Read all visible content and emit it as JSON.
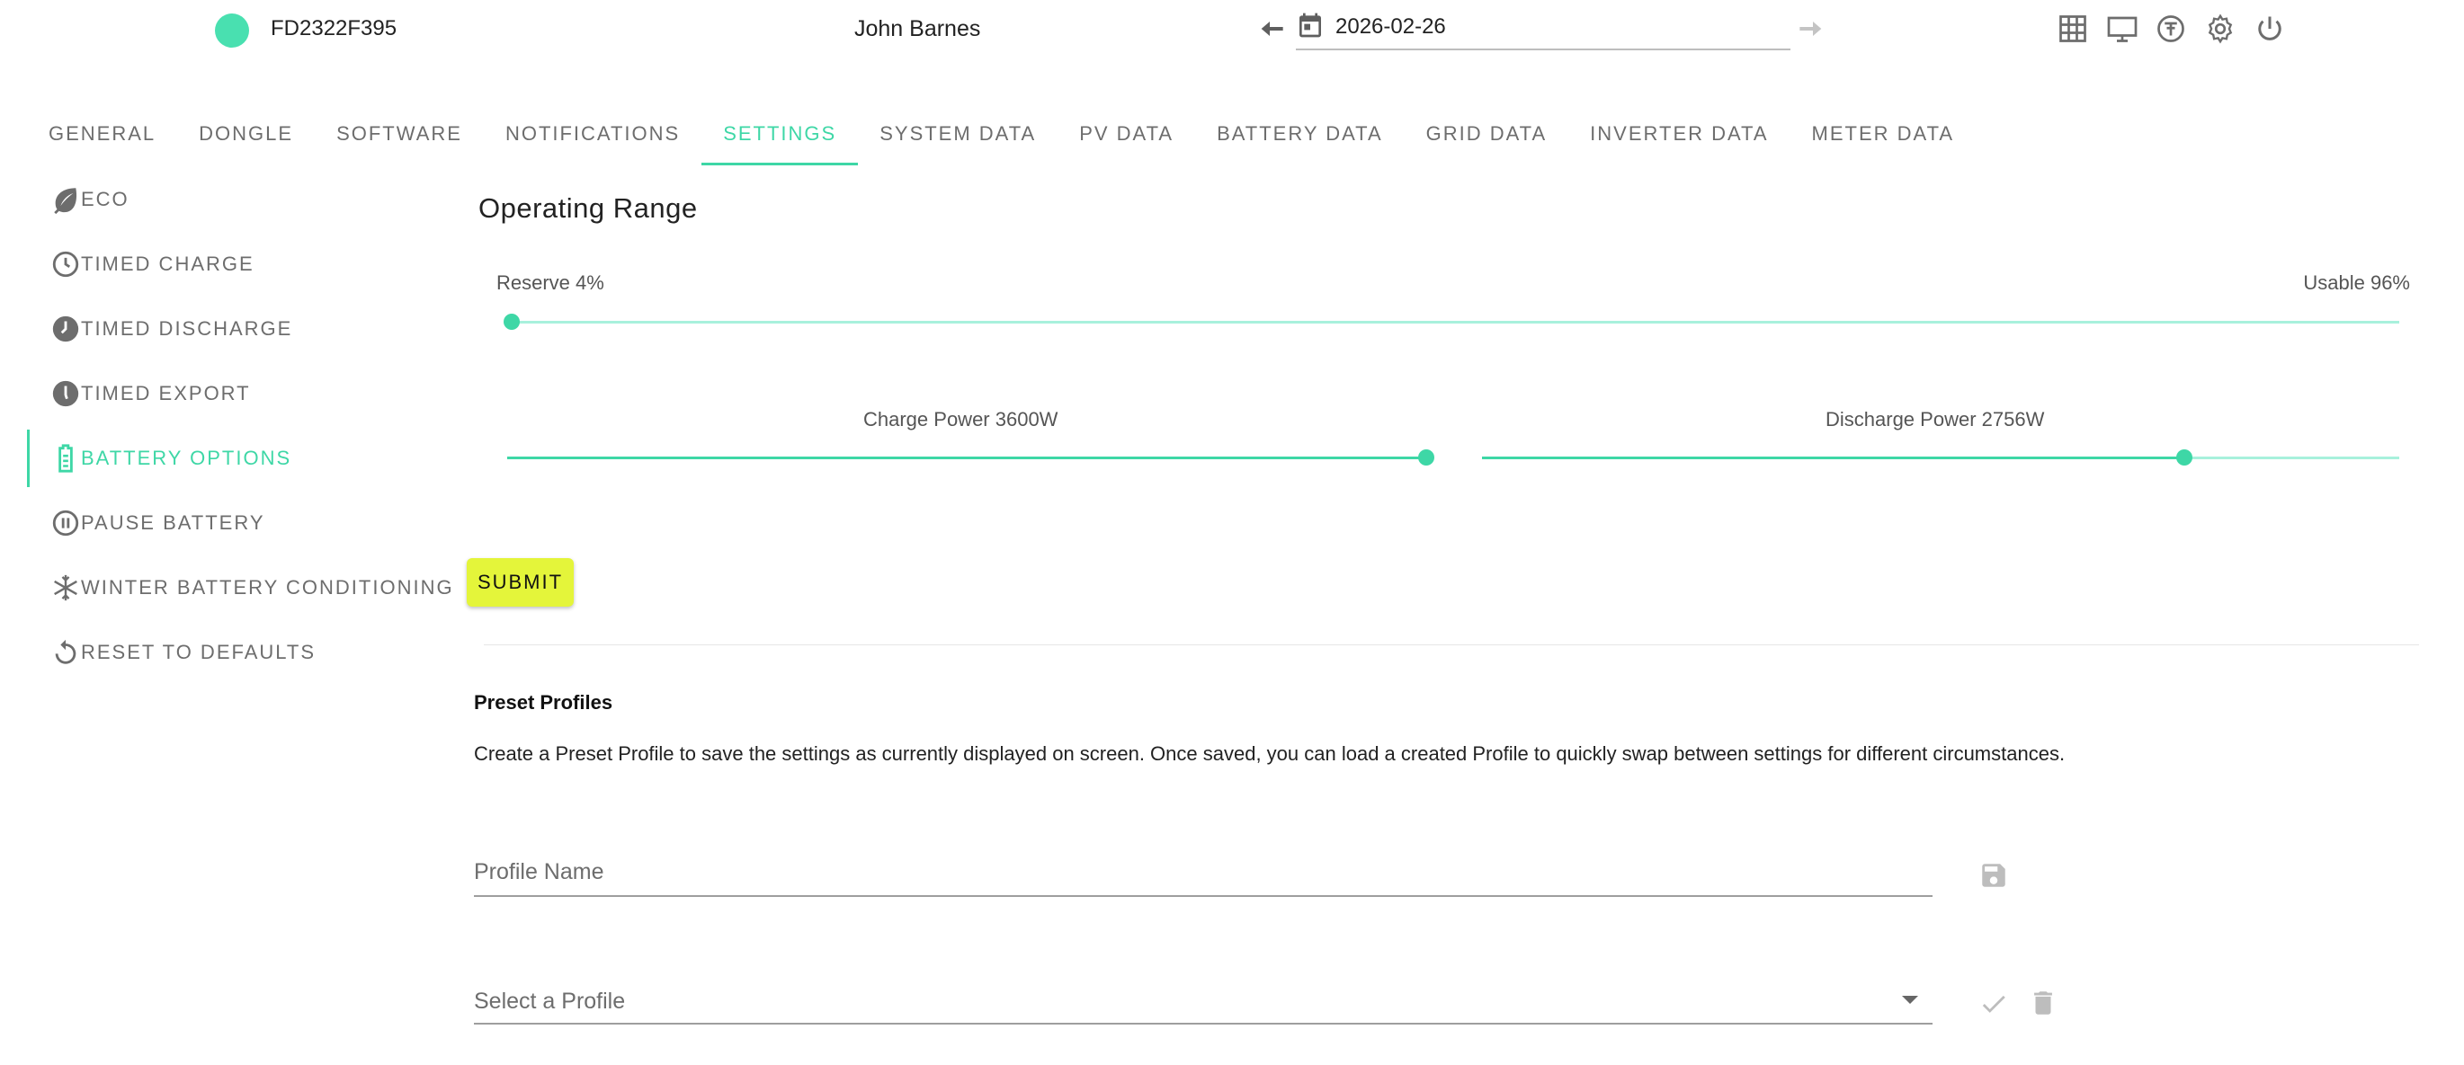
{
  "header": {
    "serial": "FD2322F395",
    "user_name": "John Barnes",
    "date": "2026-02-26",
    "status_color": "#49e0b0",
    "icons": [
      "grid-icon",
      "monitor-icon",
      "tariff-icon",
      "settings-icon",
      "power-icon"
    ]
  },
  "tabs": [
    {
      "label": "GENERAL"
    },
    {
      "label": "DONGLE"
    },
    {
      "label": "SOFTWARE"
    },
    {
      "label": "NOTIFICATIONS"
    },
    {
      "label": "SETTINGS",
      "active": true
    },
    {
      "label": "SYSTEM DATA"
    },
    {
      "label": "PV DATA"
    },
    {
      "label": "BATTERY DATA"
    },
    {
      "label": "GRID DATA"
    },
    {
      "label": "INVERTER DATA"
    },
    {
      "label": "METER DATA"
    }
  ],
  "side_menu": {
    "items": [
      {
        "label": "ECO",
        "icon": "leaf-icon"
      },
      {
        "label": "TIMED CHARGE",
        "icon": "clock-outline-icon"
      },
      {
        "label": "TIMED DISCHARGE",
        "icon": "clock-filled-icon"
      },
      {
        "label": "TIMED EXPORT",
        "icon": "clock-filled-icon"
      },
      {
        "label": "BATTERY OPTIONS",
        "icon": "battery-icon",
        "active": true
      },
      {
        "label": "PAUSE BATTERY",
        "icon": "pause-circle-icon"
      },
      {
        "label": "WINTER BATTERY CONDITIONING",
        "icon": "snowflake-icon"
      },
      {
        "label": "RESET TO DEFAULTS",
        "icon": "reset-icon"
      }
    ]
  },
  "operating_range": {
    "title": "Operating Range",
    "reserve_label": "Reserve 4%",
    "usable_label": "Usable 96%",
    "reserve_percent": 4,
    "charge_label": "Charge Power 3600W",
    "charge_fraction": 1.0,
    "discharge_label": "Discharge Power 2756W",
    "discharge_fraction": 0.766
  },
  "actions": {
    "submit_label": "SUBMIT"
  },
  "preset": {
    "title": "Preset Profiles",
    "description": "Create a Preset Profile to save the settings as currently displayed on screen. Once saved, you can load a created Profile to quickly swap between settings for different circumstances.",
    "name_placeholder": "Profile Name",
    "select_placeholder": "Select a Profile"
  },
  "colors": {
    "accent": "#3ed7a6",
    "track": "#a8f1dc",
    "submit": "#e4f53a",
    "text_muted": "#6d6d6d"
  }
}
